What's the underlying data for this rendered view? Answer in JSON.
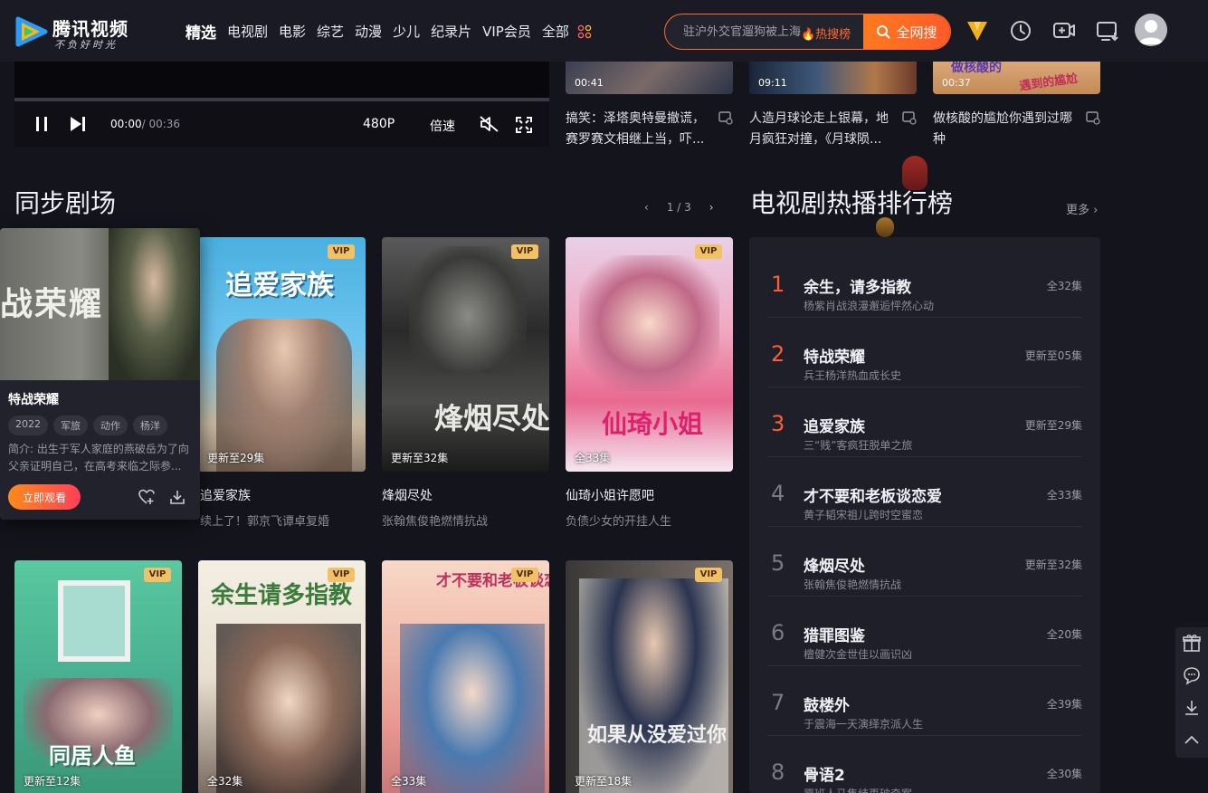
{
  "header": {
    "logo_name": "腾讯视频",
    "logo_slogan": "不负好时光",
    "nav": [
      "精选",
      "电视剧",
      "电影",
      "综艺",
      "动漫",
      "少儿",
      "纪录片",
      "VIP会员",
      "全部"
    ],
    "search_placeholder": "驻沪外交官遛狗被上海",
    "search_hot": "🔥热搜榜",
    "search_button": "全网搜"
  },
  "player": {
    "time_current": "00:00",
    "time_total": "/ 00:36",
    "quality": "480P",
    "speed": "倍速"
  },
  "short_videos": [
    {
      "duration": "00:41",
      "title": "搞笑：泽塔奥特曼撤谎，赛罗赛文相继上当，吓..."
    },
    {
      "duration": "09:11",
      "title": "人造月球论走上银幕，地月疯狂对撞，《月球陨..."
    },
    {
      "duration": "00:37",
      "title": "做核酸的尴尬你遇到过哪种",
      "thumb_text": "做核酸的",
      "thumb_text2": "遇到的尴尬"
    }
  ],
  "sync_theater": {
    "title": "同步剧场",
    "pager": "1 / 3",
    "popup": {
      "title": "特战荣耀",
      "poster_text": "战荣耀",
      "tags": [
        "2022",
        "军旅",
        "动作",
        "杨洋"
      ],
      "desc": "简介: 出生于军人家庭的燕破岳为了向父亲证明自己，在高考来临之际参...",
      "watch": "立即观看"
    },
    "cards_row1": [
      {
        "title": "追爱家族",
        "sub": "续上了！郭京飞谭卓复婚",
        "ep": "更新至29集",
        "vip": "VIP",
        "poster_text": "追爱家族"
      },
      {
        "title": "烽烟尽处",
        "sub": "张翰焦俊艳燃情抗战",
        "ep": "更新至32集",
        "vip": "VIP",
        "poster_text": "烽烟尽处"
      },
      {
        "title": "仙琦小姐许愿吧",
        "sub": "负债少女的开挂人生",
        "ep": "全33集",
        "vip": "VIP",
        "poster_text": "仙琦小姐"
      }
    ],
    "cards_row2": [
      {
        "ep": "更新至12集",
        "vip": "VIP",
        "poster_text": "同居人鱼"
      },
      {
        "ep": "全32集",
        "vip": "VIP",
        "poster_text": "余生请多指教"
      },
      {
        "ep": "全33集",
        "vip": "VIP",
        "poster_text": "才不要和老板谈恋爱"
      },
      {
        "ep": "更新至18集",
        "vip": "VIP",
        "poster_text": "如果从没爱过你"
      }
    ]
  },
  "ranking": {
    "title": "电视剧热播排行榜",
    "more": "更多 ›",
    "items": [
      {
        "rank": "1",
        "title": "余生，请多指教",
        "sub": "杨紫肖战浪漫邂逅怦然心动",
        "ep": "全32集"
      },
      {
        "rank": "2",
        "title": "特战荣耀",
        "sub": "兵王杨洋热血成长史",
        "ep": "更新至05集"
      },
      {
        "rank": "3",
        "title": "追爱家族",
        "sub": "三“贱”客疯狂脱单之旅",
        "ep": "更新至29集"
      },
      {
        "rank": "4",
        "title": "才不要和老板谈恋爱",
        "sub": "黄子韬宋祖儿跨时空蜜恋",
        "ep": "全33集"
      },
      {
        "rank": "5",
        "title": "烽烟尽处",
        "sub": "张翰焦俊艳燃情抗战",
        "ep": "更新至32集"
      },
      {
        "rank": "6",
        "title": "猎罪图鉴",
        "sub": "檀健次金世佳以画识凶",
        "ep": "全20集"
      },
      {
        "rank": "7",
        "title": "鼓楼外",
        "sub": "于震海一天演绎京派人生",
        "ep": "全39集"
      },
      {
        "rank": "8",
        "title": "骨语2",
        "sub": "原班人马集结再破奇案",
        "ep": "全30集"
      }
    ]
  },
  "colors": {
    "accent": "#ff6a2c",
    "vip": "#f2c165",
    "background": "#14141c",
    "panel": "#1f1f29"
  }
}
